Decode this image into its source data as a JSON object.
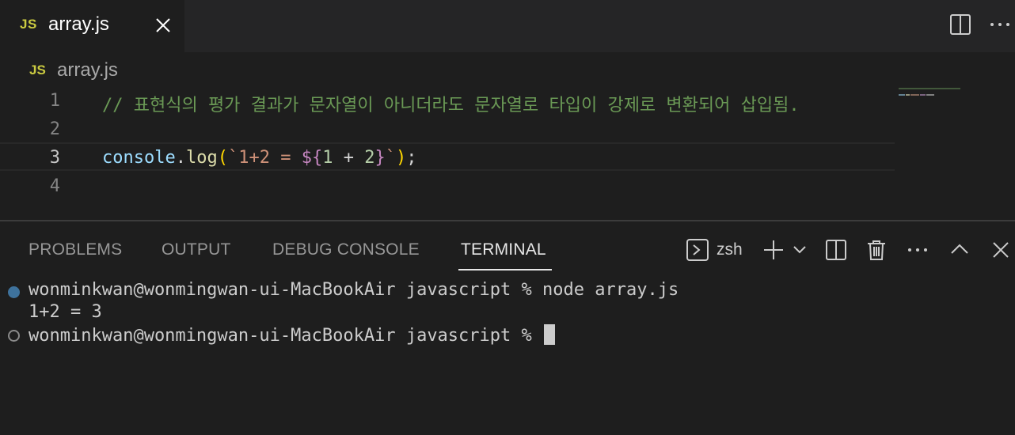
{
  "tab": {
    "badge": "JS",
    "title": "array.js"
  },
  "breadcrumb": {
    "badge": "JS",
    "file": "array.js"
  },
  "editor": {
    "lines": [
      {
        "number": "1",
        "comment": "// 표현식의 평가 결과가 문자열이 아니더라도 문자열로 타입이 강제로 변환되어 삽입됨."
      },
      {
        "number": "2"
      },
      {
        "number": "3",
        "tokens": {
          "obj": "console",
          "dot": ".",
          "method": "log",
          "open_paren": "(",
          "backtick_open": "`",
          "str": "1+2 = ",
          "tpl_open": "${",
          "num1": "1",
          "op": " + ",
          "num2": "2",
          "tpl_close": "}",
          "backtick_close": "`",
          "close_paren": ")",
          "semi": ";"
        }
      },
      {
        "number": "4"
      }
    ]
  },
  "panel": {
    "tabs": [
      "PROBLEMS",
      "OUTPUT",
      "DEBUG CONSOLE",
      "TERMINAL"
    ],
    "active_tab": "TERMINAL",
    "shell": "zsh"
  },
  "terminal": {
    "lines": [
      "wonminkwan@wonmingwan-ui-MacBookAir javascript % node array.js",
      "1+2 = 3",
      "wonminkwan@wonmingwan-ui-MacBookAir javascript % "
    ]
  },
  "colors": {
    "background": "#1e1e1e",
    "tabbar": "#252526",
    "comment": "#6a9955",
    "js_badge": "#cbcb41"
  }
}
